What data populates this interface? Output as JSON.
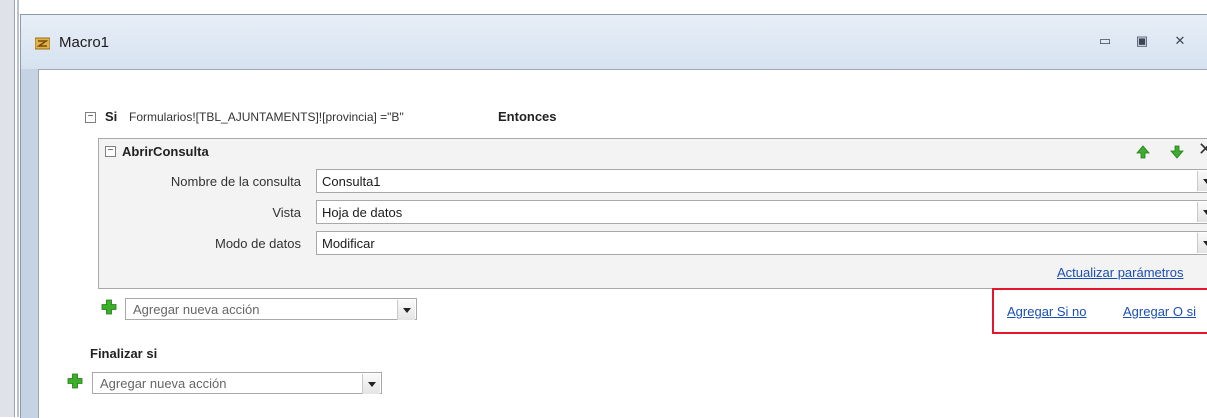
{
  "window": {
    "title": "Macro1",
    "title_icon": "macro-icon",
    "controls": {
      "minimize": "▭",
      "maximize": "▣",
      "close": "✕"
    }
  },
  "if_block": {
    "keyword": "Si",
    "condition": "Formularios![TBL_AJUNTAMENTS]![provincia] =\"B\"",
    "then_keyword": "Entonces",
    "collapse_symbol": "−",
    "action": {
      "name": "AbrirConsulta",
      "collapse_symbol": "−",
      "params": [
        {
          "label": "Nombre de la consulta",
          "value": "Consulta1"
        },
        {
          "label": "Vista",
          "value": "Hoja de datos"
        },
        {
          "label": "Modo de datos",
          "value": "Modificar"
        }
      ],
      "update_params_link": "Actualizar parámetros",
      "move_up_icon": "green-up-arrow-icon",
      "move_down_icon": "green-down-arrow-icon",
      "delete_icon": "close-icon"
    },
    "add_action_placeholder": "Agregar nueva acción",
    "add_else_link": "Agregar Si no",
    "add_elseif_link": "Agregar O si"
  },
  "end_if": "Finalizar si",
  "root_add_action_placeholder": "Agregar nueva acción",
  "colors": {
    "accent_link": "#1a4fb5",
    "highlight": "#e3162c",
    "plus_green": "#3cae2c"
  }
}
